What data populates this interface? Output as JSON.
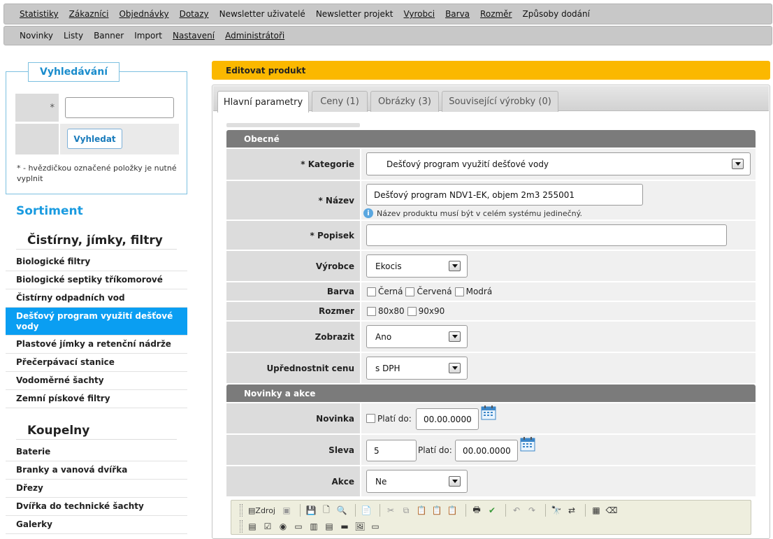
{
  "menu_top": [
    {
      "label": "Statistiky",
      "underline": true
    },
    {
      "label": "Zákazníci",
      "underline": true
    },
    {
      "label": "Objednávky",
      "underline": true
    },
    {
      "label": "Dotazy",
      "underline": true
    },
    {
      "label": "Newsletter uživatelé",
      "underline": false
    },
    {
      "label": "Newsletter projekt",
      "underline": false
    },
    {
      "label": "Vyrobci",
      "underline": true
    },
    {
      "label": "Barva",
      "underline": true
    },
    {
      "label": "Rozměr",
      "underline": true
    },
    {
      "label": "Způsoby dodání",
      "underline": false
    }
  ],
  "menu_second": [
    {
      "label": "Novinky",
      "underline": false
    },
    {
      "label": "Listy",
      "underline": false
    },
    {
      "label": "Banner",
      "underline": false
    },
    {
      "label": "Import",
      "underline": false
    },
    {
      "label": "Nastavení",
      "underline": true
    },
    {
      "label": "Administrátoři",
      "underline": true
    }
  ],
  "search": {
    "legend": "Vyhledávání",
    "required_mark": "*",
    "input_value": "",
    "button": "Vyhledat",
    "note": "* - hvězdičkou označené položky je nutné vyplnit"
  },
  "sidebar": {
    "heading": "Sortiment",
    "groups": [
      {
        "title": "Čistírny, jímky, filtry",
        "items": [
          "Biologické filtry",
          "Biologické septiky tříkomorové",
          "Čistírny odpadních vod",
          "Dešťový program využití dešťové vody",
          "Plastové jímky a retenční nádrže",
          "Přečerpávací stanice",
          "Vodoměrné šachty",
          "Zemní pískové filtry"
        ],
        "selected": 3
      },
      {
        "title": "Koupelny",
        "items": [
          "Baterie",
          "Branky a vanová dvířka",
          "Dřezy",
          "Dvířka do technické šachty",
          "Galerky"
        ],
        "selected": -1
      }
    ]
  },
  "main": {
    "title": "Editovat produkt",
    "tabs": [
      "Hlavní parametry",
      "Ceny (1)",
      "Obrázky (3)",
      "Související výrobky (0)"
    ],
    "active_tab": 0,
    "sections": {
      "general": "Obecné",
      "news": "Novinky a akce"
    },
    "fields": {
      "kategorie": {
        "label": "* Kategorie",
        "value": "Dešťový program využití dešťové vody"
      },
      "nazev": {
        "label": "* Název",
        "value": "Dešťový program NDV1-EK, objem 2m3 255001",
        "hint": "Název produktu musí být v celém systému jedinečný."
      },
      "popisek": {
        "label": "* Popisek",
        "value": ""
      },
      "vyrobce": {
        "label": "Výrobce",
        "value": "Ekocis"
      },
      "barva": {
        "label": "Barva",
        "options": [
          "Černá",
          "Červená",
          "Modrá"
        ]
      },
      "rozmer": {
        "label": "Rozmer",
        "options": [
          "80x80",
          "90x90"
        ]
      },
      "zobrazit": {
        "label": "Zobrazit",
        "value": "Ano"
      },
      "cena": {
        "label": "Upřednostnit cenu",
        "value": "s DPH"
      },
      "novinka": {
        "label": "Novinka",
        "valid_label": "Platí do:",
        "date": "00.00.0000"
      },
      "sleva": {
        "label": "Sleva",
        "value": "5",
        "valid_label": "Platí do:",
        "date": "00.00.0000"
      },
      "akce": {
        "label": "Akce",
        "value": "Ne"
      }
    },
    "editor": {
      "source_label": "Zdroj"
    }
  }
}
